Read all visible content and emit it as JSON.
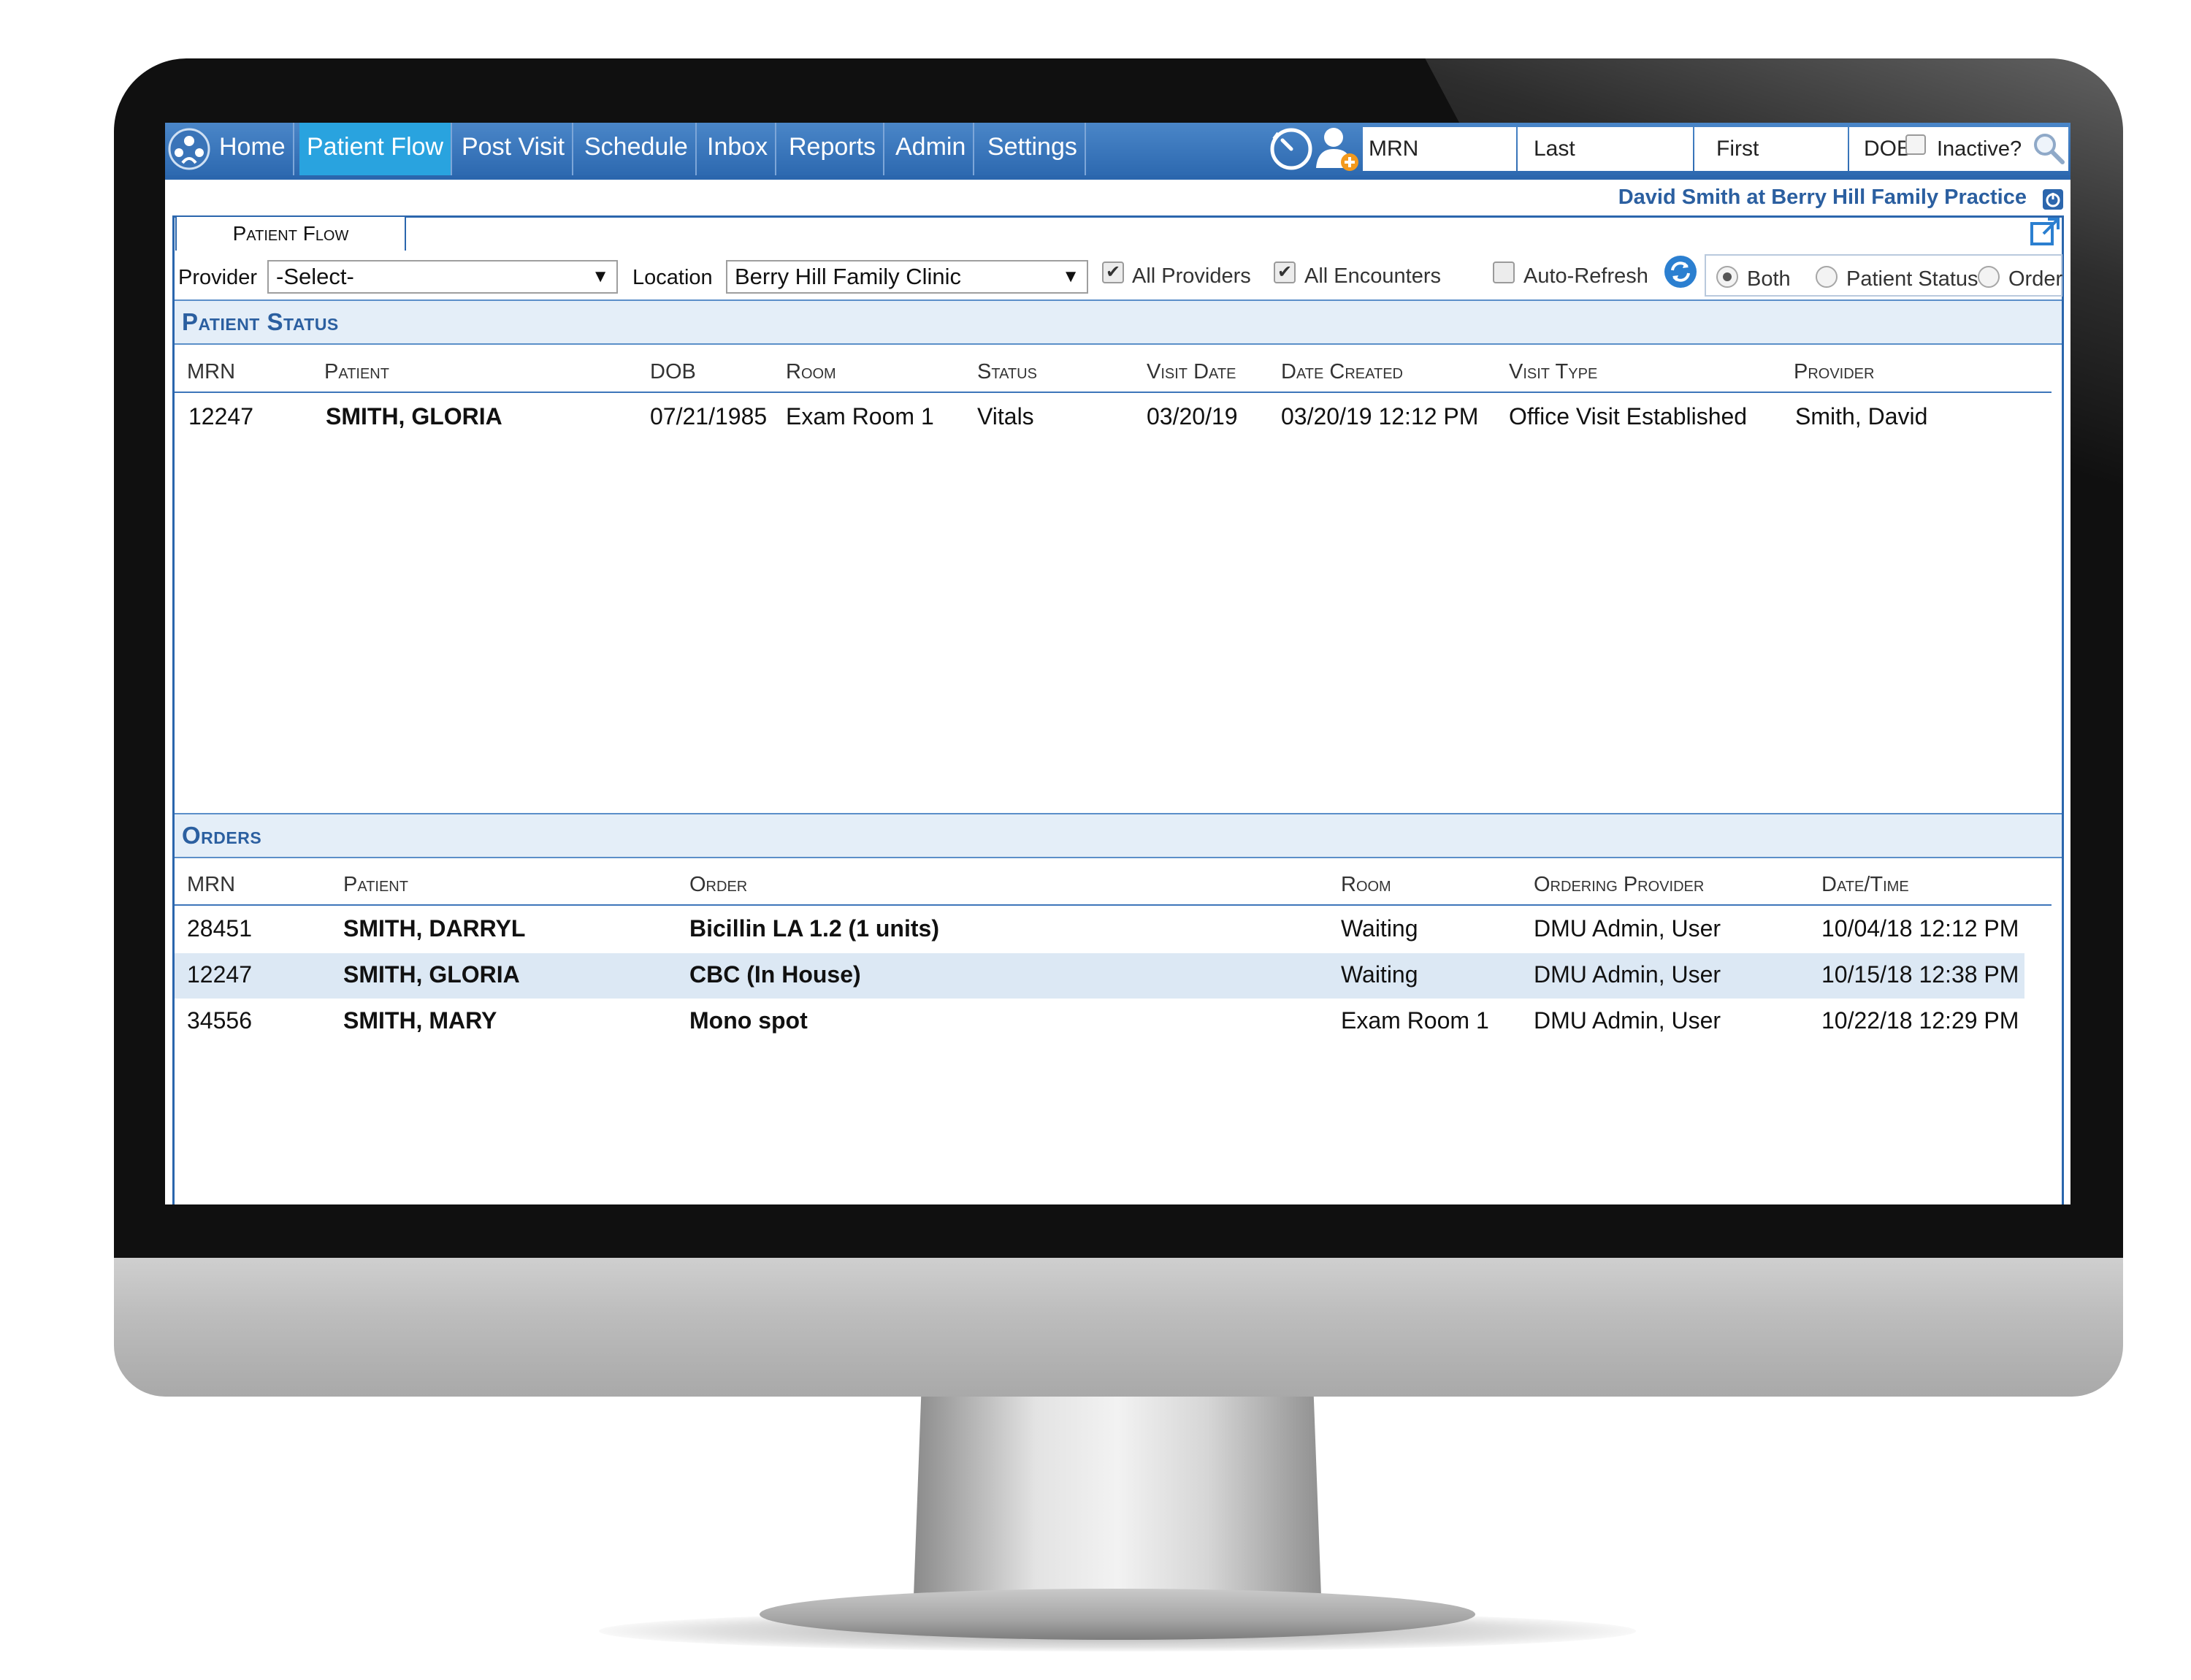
{
  "nav": {
    "items": [
      "Home",
      "Patient Flow",
      "Post Visit",
      "Schedule",
      "Inbox",
      "Reports",
      "Admin",
      "Settings"
    ],
    "active": "Patient Flow"
  },
  "search": {
    "mrn": "MRN",
    "last": "Last",
    "first": "First",
    "dob": "DOB",
    "inactive_label": "Inactive?"
  },
  "user_line": "David Smith at Berry Hill Family Practice",
  "tab_label": "Patient Flow",
  "filters": {
    "provider_label": "Provider",
    "provider_value": "-Select-",
    "location_label": "Location",
    "location_value": "Berry Hill Family Clinic",
    "all_providers": "All Providers",
    "all_encounters": "All Encounters",
    "auto_refresh": "Auto-Refresh",
    "radio_both": "Both",
    "radio_patient_status": "Patient Status",
    "radio_order": "Order",
    "all_providers_checked": true,
    "all_encounters_checked": true,
    "auto_refresh_checked": false,
    "selected_radio": "Both"
  },
  "patient_status": {
    "title": "Patient Status",
    "headers": [
      "MRN",
      "Patient",
      "DOB",
      "Room",
      "Status",
      "Visit Date",
      "Date Created",
      "Visit Type",
      "Provider"
    ],
    "rows": [
      [
        "12247",
        "SMITH, GLORIA",
        "07/21/1985",
        "Exam Room 1",
        "Vitals",
        "03/20/19",
        "03/20/19 12:12 PM",
        "Office Visit Established",
        "Smith, David"
      ]
    ]
  },
  "orders": {
    "title": "Orders",
    "headers": [
      "MRN",
      "Patient",
      "Order",
      "Room",
      "Ordering Provider",
      "Date/Time"
    ],
    "rows": [
      [
        "28451",
        "SMITH, DARRYL",
        "Bicillin LA 1.2 (1 units)",
        "Waiting",
        "DMU Admin, User",
        "10/04/18 12:12 PM"
      ],
      [
        "12247",
        "SMITH, GLORIA",
        "CBC (In House)",
        "Waiting",
        "DMU Admin, User",
        "10/15/18 12:38 PM"
      ],
      [
        "34556",
        "SMITH, MARY",
        "Mono spot",
        "Exam Room 1",
        "DMU Admin, User",
        "10/22/18 12:29 PM"
      ]
    ]
  },
  "colors": {
    "nav_bar": "#2d69b0",
    "nav_active": "#29a3df",
    "section_bar": "#e4eef8",
    "accent_text": "#2b5fa0",
    "row_highlight": "#dce8f4"
  }
}
